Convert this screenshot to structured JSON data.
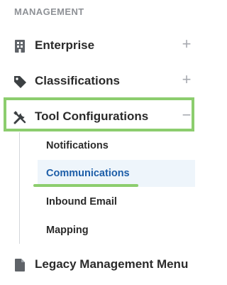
{
  "sidebar": {
    "section_header": "MANAGEMENT",
    "items": [
      {
        "label": "Enterprise",
        "icon": "building-icon",
        "toggle": "+"
      },
      {
        "label": "Classifications",
        "icon": "tag-icon",
        "toggle": "+"
      },
      {
        "label": "Tool Configurations",
        "icon": "tools-icon",
        "toggle": "−",
        "expanded": true
      },
      {
        "label": "Legacy Management Menu",
        "icon": "document-icon"
      }
    ],
    "sub_items": [
      {
        "label": "Notifications"
      },
      {
        "label": "Communications",
        "active": true
      },
      {
        "label": "Inbound Email"
      },
      {
        "label": "Mapping"
      }
    ]
  },
  "colors": {
    "highlight_green": "#8ccd6e",
    "active_text": "#1d5ea8",
    "active_background": "#eef5fb",
    "header_gray": "#8e9196"
  }
}
